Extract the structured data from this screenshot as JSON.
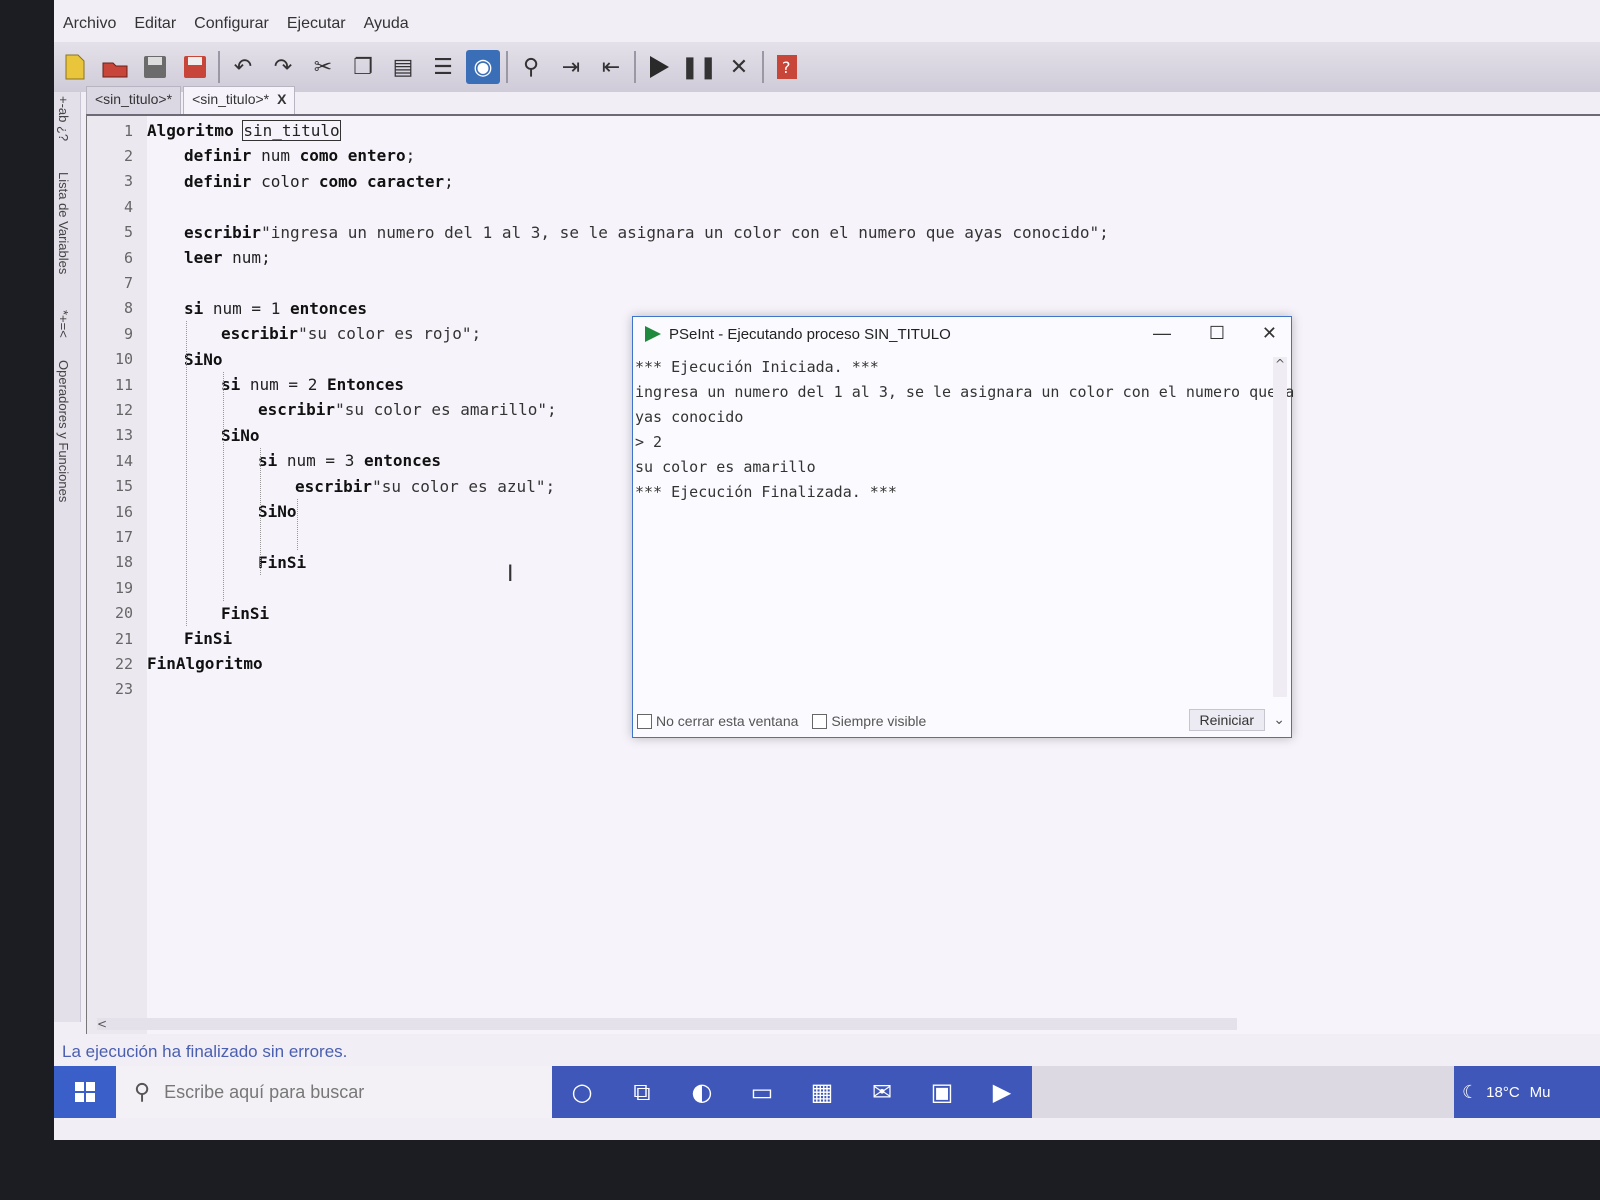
{
  "menu": [
    "Archivo",
    "Editar",
    "Configurar",
    "Ejecutar",
    "Ayuda"
  ],
  "toolbar_icons": [
    "new-file-icon",
    "open-icon",
    "save-icon",
    "save-as-icon",
    "undo-icon",
    "redo-icon",
    "cut-icon",
    "copy-icon",
    "paste-icon",
    "list-icon",
    "eye-icon",
    "find-icon",
    "indent-icon",
    "unindent-icon",
    "run-icon",
    "step-icon",
    "debug-icon",
    "help-icon"
  ],
  "side_panel": {
    "variables_label": "Lista de Variables",
    "operators_label": "Operadores y Funciones",
    "operators_glyphs": "*+=<",
    "variables_glyphs": "+-ab ¿?"
  },
  "tabs": [
    {
      "label": "<sin_titulo>*"
    },
    {
      "label": "<sin_titulo>*",
      "close": "X"
    }
  ],
  "editor": {
    "lines": [
      {
        "n": "1",
        "indent": 0,
        "parts": [
          [
            "kw",
            "Algoritmo"
          ],
          [
            "tx",
            " "
          ],
          [
            "sel",
            "sin_titulo"
          ]
        ]
      },
      {
        "n": "2",
        "indent": 1,
        "parts": [
          [
            "kw",
            "definir"
          ],
          [
            "tx",
            " num "
          ],
          [
            "kw",
            "como"
          ],
          [
            "tx",
            " "
          ],
          [
            "kw",
            "entero"
          ],
          [
            "tx",
            ";"
          ]
        ]
      },
      {
        "n": "3",
        "indent": 1,
        "parts": [
          [
            "kw",
            "definir"
          ],
          [
            "tx",
            " color "
          ],
          [
            "kw",
            "como"
          ],
          [
            "tx",
            " "
          ],
          [
            "kw",
            "caracter"
          ],
          [
            "tx",
            ";"
          ]
        ]
      },
      {
        "n": "4",
        "indent": 0,
        "parts": []
      },
      {
        "n": "5",
        "indent": 1,
        "parts": [
          [
            "kw",
            "escribir"
          ],
          [
            "str",
            "\"ingresa un numero del 1 al 3, se le asignara un color con el numero que ayas conocido\";"
          ]
        ]
      },
      {
        "n": "6",
        "indent": 1,
        "parts": [
          [
            "kw",
            "leer"
          ],
          [
            "tx",
            " num;"
          ]
        ]
      },
      {
        "n": "7",
        "indent": 0,
        "parts": []
      },
      {
        "n": "8",
        "indent": 1,
        "parts": [
          [
            "kw",
            "si"
          ],
          [
            "tx",
            " num = 1 "
          ],
          [
            "kw",
            "entonces"
          ]
        ]
      },
      {
        "n": "9",
        "indent": 2,
        "parts": [
          [
            "kw",
            "escribir"
          ],
          [
            "str",
            "\"su color es rojo\";"
          ]
        ]
      },
      {
        "n": "10",
        "indent": 1,
        "parts": [
          [
            "kw",
            "SiNo"
          ]
        ]
      },
      {
        "n": "11",
        "indent": 2,
        "parts": [
          [
            "kw",
            "si"
          ],
          [
            "tx",
            " num = 2 "
          ],
          [
            "kw",
            "Entonces"
          ]
        ]
      },
      {
        "n": "12",
        "indent": 3,
        "parts": [
          [
            "kw",
            "escribir"
          ],
          [
            "str",
            "\"su color es amarillo\";"
          ]
        ]
      },
      {
        "n": "13",
        "indent": 2,
        "parts": [
          [
            "kw",
            "SiNo"
          ]
        ]
      },
      {
        "n": "14",
        "indent": 3,
        "parts": [
          [
            "kw",
            "si"
          ],
          [
            "tx",
            " num = 3 "
          ],
          [
            "kw",
            "entonces"
          ]
        ]
      },
      {
        "n": "15",
        "indent": 4,
        "parts": [
          [
            "kw",
            "escribir"
          ],
          [
            "str",
            "\"su color es azul\";"
          ]
        ]
      },
      {
        "n": "16",
        "indent": 3,
        "parts": [
          [
            "kw",
            "SiNo"
          ]
        ]
      },
      {
        "n": "17",
        "indent": 0,
        "parts": []
      },
      {
        "n": "18",
        "indent": 3,
        "parts": [
          [
            "kw",
            "FinSi"
          ]
        ]
      },
      {
        "n": "19",
        "indent": 0,
        "parts": []
      },
      {
        "n": "20",
        "indent": 2,
        "parts": [
          [
            "kw",
            "FinSi"
          ]
        ]
      },
      {
        "n": "21",
        "indent": 1,
        "parts": [
          [
            "kw",
            "FinSi"
          ]
        ]
      },
      {
        "n": "22",
        "indent": 0,
        "parts": [
          [
            "kw",
            "FinAlgoritmo"
          ]
        ]
      },
      {
        "n": "23",
        "indent": 0,
        "parts": []
      }
    ],
    "hscroll_arrow": "<"
  },
  "status_text": "La ejecución ha finalizado sin errores.",
  "run_window": {
    "title": "PSeInt - Ejecutando proceso SIN_TITULO",
    "minimize": "—",
    "maximize": "☐",
    "close": "✕",
    "console": [
      "*** Ejecución Iniciada. ***",
      "ingresa un numero del 1 al 3, se le asignara un color con el numero que a",
      "yas conocido",
      "> 2",
      "su color es amarillo",
      "*** Ejecución Finalizada. ***"
    ],
    "no_close_label": "No cerrar esta ventana",
    "always_visible_label": "Siempre visible",
    "restart_label": "Reiniciar",
    "dropdown_arrow": "⌄",
    "scroll_up": "^"
  },
  "taskbar": {
    "search_placeholder": "Escribe aquí para buscar",
    "weather": "18°C",
    "weather_suffix": "Mu",
    "icons": [
      "cortana-icon",
      "task-view-icon",
      "edge-icon",
      "file-explorer-icon",
      "store-icon",
      "mail-icon",
      "office-icon",
      "pseint-icon"
    ]
  },
  "colors": {
    "status_text": "#4a5fb0",
    "taskbar_accent": "#3f57b8",
    "window_border": "#3e74c9",
    "run_green": "#1f8a3e"
  }
}
